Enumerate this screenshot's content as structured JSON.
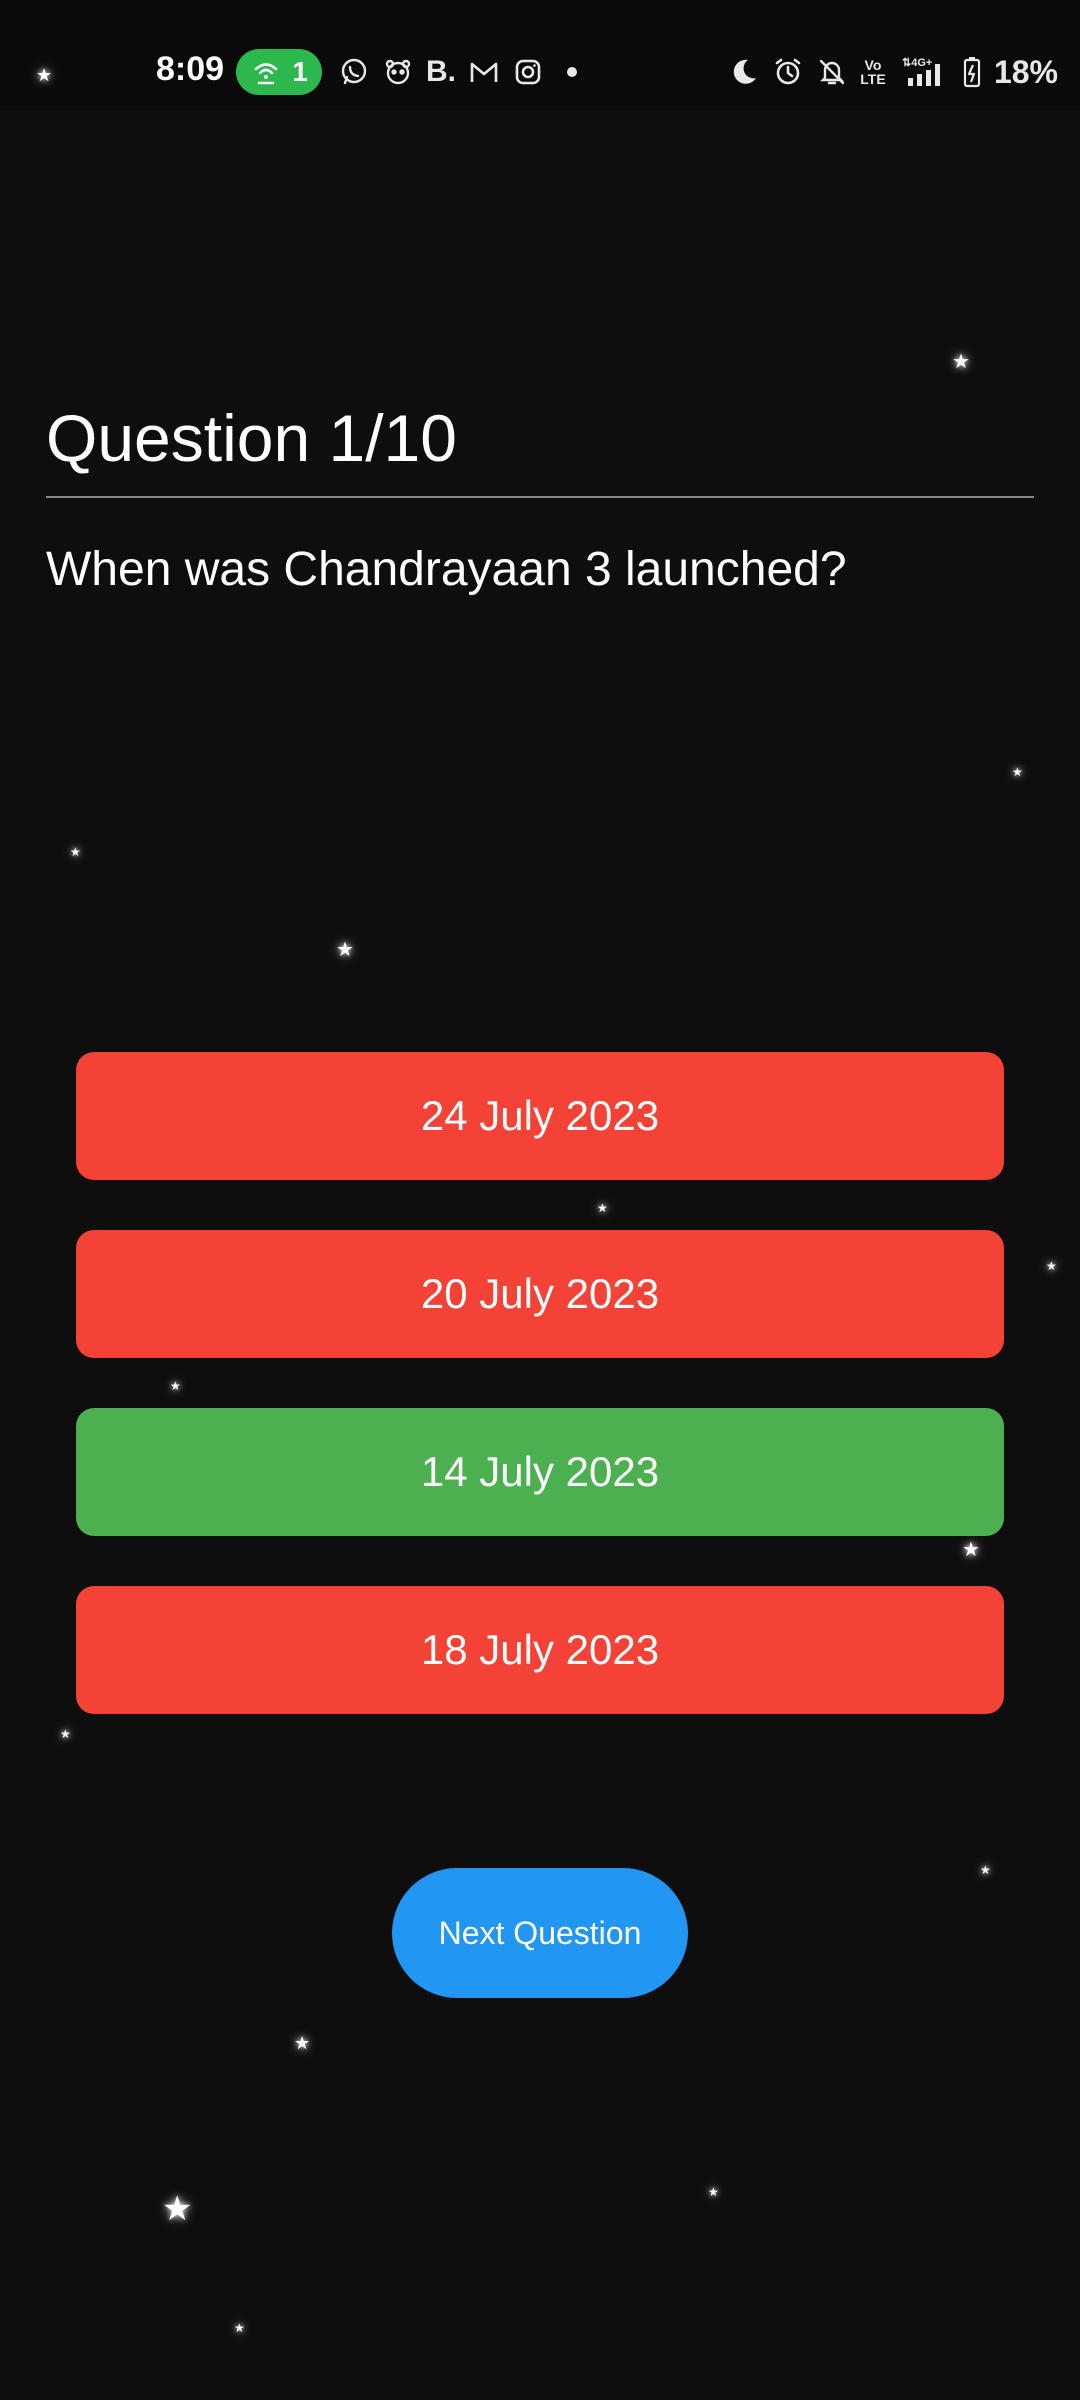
{
  "status_bar": {
    "time": "8:09",
    "hotspot_count": "1",
    "battery_percent": "18%",
    "network_label": "4G",
    "volte_label": "Vo LTE",
    "left_icons": [
      "hotspot-icon",
      "whatsapp-icon",
      "bear-app-icon",
      "b-app-icon",
      "gmail-icon",
      "instagram-icon",
      "dot-icon"
    ],
    "right_icons": [
      "moon-icon",
      "alarm-icon",
      "mute-icon",
      "volte-icon",
      "signal-icon",
      "battery-icon"
    ],
    "b_app_glyph": "B."
  },
  "quiz": {
    "header": "Question 1/10",
    "question": "When was Chandrayaan 3 launched?",
    "answers": [
      {
        "label": "24 July 2023",
        "state": "wrong",
        "color": "#f44336"
      },
      {
        "label": "20 July 2023",
        "state": "wrong",
        "color": "#f44336"
      },
      {
        "label": "14 July 2023",
        "state": "correct",
        "color": "#4caf50"
      },
      {
        "label": "18 July 2023",
        "state": "wrong",
        "color": "#f44336"
      }
    ],
    "next_button": "Next Question"
  },
  "colors": {
    "background": "#0e0e0e",
    "wrong": "#f44336",
    "correct": "#4caf50",
    "accent": "#2196f3",
    "hotspot_pill": "#2db84d"
  }
}
